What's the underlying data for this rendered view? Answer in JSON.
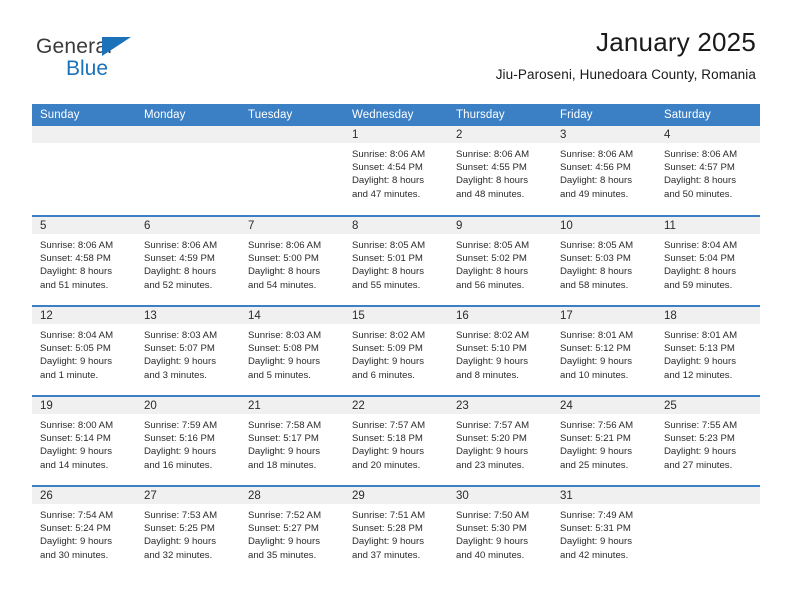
{
  "brand": {
    "name_part1": "General",
    "name_part2": "Blue",
    "accent_color": "#1b72b8",
    "triangle_icon": "triangle-icon"
  },
  "header": {
    "title": "January 2025",
    "subtitle": "Jiu-Paroseni, Hunedoara County, Romania"
  },
  "calendar": {
    "header_bg": "#3b7fc4",
    "daynum_bg": "#f0f0f0",
    "weekday_headers": [
      "Sunday",
      "Monday",
      "Tuesday",
      "Wednesday",
      "Thursday",
      "Friday",
      "Saturday"
    ],
    "weeks": [
      [
        {
          "day": "",
          "empty": true
        },
        {
          "day": "",
          "empty": true
        },
        {
          "day": "",
          "empty": true
        },
        {
          "day": "1",
          "sunrise": "Sunrise: 8:06 AM",
          "sunset": "Sunset: 4:54 PM",
          "daylight_line1": "Daylight: 8 hours",
          "daylight_line2": "and 47 minutes."
        },
        {
          "day": "2",
          "sunrise": "Sunrise: 8:06 AM",
          "sunset": "Sunset: 4:55 PM",
          "daylight_line1": "Daylight: 8 hours",
          "daylight_line2": "and 48 minutes."
        },
        {
          "day": "3",
          "sunrise": "Sunrise: 8:06 AM",
          "sunset": "Sunset: 4:56 PM",
          "daylight_line1": "Daylight: 8 hours",
          "daylight_line2": "and 49 minutes."
        },
        {
          "day": "4",
          "sunrise": "Sunrise: 8:06 AM",
          "sunset": "Sunset: 4:57 PM",
          "daylight_line1": "Daylight: 8 hours",
          "daylight_line2": "and 50 minutes."
        }
      ],
      [
        {
          "day": "5",
          "sunrise": "Sunrise: 8:06 AM",
          "sunset": "Sunset: 4:58 PM",
          "daylight_line1": "Daylight: 8 hours",
          "daylight_line2": "and 51 minutes."
        },
        {
          "day": "6",
          "sunrise": "Sunrise: 8:06 AM",
          "sunset": "Sunset: 4:59 PM",
          "daylight_line1": "Daylight: 8 hours",
          "daylight_line2": "and 52 minutes."
        },
        {
          "day": "7",
          "sunrise": "Sunrise: 8:06 AM",
          "sunset": "Sunset: 5:00 PM",
          "daylight_line1": "Daylight: 8 hours",
          "daylight_line2": "and 54 minutes."
        },
        {
          "day": "8",
          "sunrise": "Sunrise: 8:05 AM",
          "sunset": "Sunset: 5:01 PM",
          "daylight_line1": "Daylight: 8 hours",
          "daylight_line2": "and 55 minutes."
        },
        {
          "day": "9",
          "sunrise": "Sunrise: 8:05 AM",
          "sunset": "Sunset: 5:02 PM",
          "daylight_line1": "Daylight: 8 hours",
          "daylight_line2": "and 56 minutes."
        },
        {
          "day": "10",
          "sunrise": "Sunrise: 8:05 AM",
          "sunset": "Sunset: 5:03 PM",
          "daylight_line1": "Daylight: 8 hours",
          "daylight_line2": "and 58 minutes."
        },
        {
          "day": "11",
          "sunrise": "Sunrise: 8:04 AM",
          "sunset": "Sunset: 5:04 PM",
          "daylight_line1": "Daylight: 8 hours",
          "daylight_line2": "and 59 minutes."
        }
      ],
      [
        {
          "day": "12",
          "sunrise": "Sunrise: 8:04 AM",
          "sunset": "Sunset: 5:05 PM",
          "daylight_line1": "Daylight: 9 hours",
          "daylight_line2": "and 1 minute."
        },
        {
          "day": "13",
          "sunrise": "Sunrise: 8:03 AM",
          "sunset": "Sunset: 5:07 PM",
          "daylight_line1": "Daylight: 9 hours",
          "daylight_line2": "and 3 minutes."
        },
        {
          "day": "14",
          "sunrise": "Sunrise: 8:03 AM",
          "sunset": "Sunset: 5:08 PM",
          "daylight_line1": "Daylight: 9 hours",
          "daylight_line2": "and 5 minutes."
        },
        {
          "day": "15",
          "sunrise": "Sunrise: 8:02 AM",
          "sunset": "Sunset: 5:09 PM",
          "daylight_line1": "Daylight: 9 hours",
          "daylight_line2": "and 6 minutes."
        },
        {
          "day": "16",
          "sunrise": "Sunrise: 8:02 AM",
          "sunset": "Sunset: 5:10 PM",
          "daylight_line1": "Daylight: 9 hours",
          "daylight_line2": "and 8 minutes."
        },
        {
          "day": "17",
          "sunrise": "Sunrise: 8:01 AM",
          "sunset": "Sunset: 5:12 PM",
          "daylight_line1": "Daylight: 9 hours",
          "daylight_line2": "and 10 minutes."
        },
        {
          "day": "18",
          "sunrise": "Sunrise: 8:01 AM",
          "sunset": "Sunset: 5:13 PM",
          "daylight_line1": "Daylight: 9 hours",
          "daylight_line2": "and 12 minutes."
        }
      ],
      [
        {
          "day": "19",
          "sunrise": "Sunrise: 8:00 AM",
          "sunset": "Sunset: 5:14 PM",
          "daylight_line1": "Daylight: 9 hours",
          "daylight_line2": "and 14 minutes."
        },
        {
          "day": "20",
          "sunrise": "Sunrise: 7:59 AM",
          "sunset": "Sunset: 5:16 PM",
          "daylight_line1": "Daylight: 9 hours",
          "daylight_line2": "and 16 minutes."
        },
        {
          "day": "21",
          "sunrise": "Sunrise: 7:58 AM",
          "sunset": "Sunset: 5:17 PM",
          "daylight_line1": "Daylight: 9 hours",
          "daylight_line2": "and 18 minutes."
        },
        {
          "day": "22",
          "sunrise": "Sunrise: 7:57 AM",
          "sunset": "Sunset: 5:18 PM",
          "daylight_line1": "Daylight: 9 hours",
          "daylight_line2": "and 20 minutes."
        },
        {
          "day": "23",
          "sunrise": "Sunrise: 7:57 AM",
          "sunset": "Sunset: 5:20 PM",
          "daylight_line1": "Daylight: 9 hours",
          "daylight_line2": "and 23 minutes."
        },
        {
          "day": "24",
          "sunrise": "Sunrise: 7:56 AM",
          "sunset": "Sunset: 5:21 PM",
          "daylight_line1": "Daylight: 9 hours",
          "daylight_line2": "and 25 minutes."
        },
        {
          "day": "25",
          "sunrise": "Sunrise: 7:55 AM",
          "sunset": "Sunset: 5:23 PM",
          "daylight_line1": "Daylight: 9 hours",
          "daylight_line2": "and 27 minutes."
        }
      ],
      [
        {
          "day": "26",
          "sunrise": "Sunrise: 7:54 AM",
          "sunset": "Sunset: 5:24 PM",
          "daylight_line1": "Daylight: 9 hours",
          "daylight_line2": "and 30 minutes."
        },
        {
          "day": "27",
          "sunrise": "Sunrise: 7:53 AM",
          "sunset": "Sunset: 5:25 PM",
          "daylight_line1": "Daylight: 9 hours",
          "daylight_line2": "and 32 minutes."
        },
        {
          "day": "28",
          "sunrise": "Sunrise: 7:52 AM",
          "sunset": "Sunset: 5:27 PM",
          "daylight_line1": "Daylight: 9 hours",
          "daylight_line2": "and 35 minutes."
        },
        {
          "day": "29",
          "sunrise": "Sunrise: 7:51 AM",
          "sunset": "Sunset: 5:28 PM",
          "daylight_line1": "Daylight: 9 hours",
          "daylight_line2": "and 37 minutes."
        },
        {
          "day": "30",
          "sunrise": "Sunrise: 7:50 AM",
          "sunset": "Sunset: 5:30 PM",
          "daylight_line1": "Daylight: 9 hours",
          "daylight_line2": "and 40 minutes."
        },
        {
          "day": "31",
          "sunrise": "Sunrise: 7:49 AM",
          "sunset": "Sunset: 5:31 PM",
          "daylight_line1": "Daylight: 9 hours",
          "daylight_line2": "and 42 minutes."
        },
        {
          "day": "",
          "empty": true
        }
      ]
    ]
  }
}
